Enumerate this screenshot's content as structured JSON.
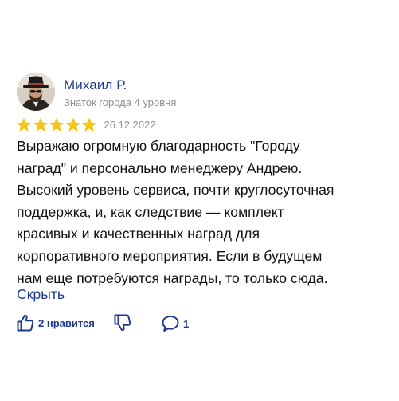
{
  "review": {
    "author": {
      "name": "Михаил Р.",
      "level": "Знаток города 4 уровня"
    },
    "rating": 5,
    "rating_max": 5,
    "date": "26.12.2022",
    "text_lines": [
      "Выражаю огромную благодарность \"Городу",
      "наград\" и персонально менеджеру Андрею.",
      "Высокий уровень сервиса, почти круглосуточная",
      "поддержка, и, как следствие — комплект",
      "красивых и качественных наград для",
      "корпоративного мероприятия. Если в будущем",
      "нам еще потребуются награды, то только сюда."
    ],
    "collapse_label": "Скрыть",
    "likes_label": "2 нравится",
    "comments_count": "1"
  },
  "colors": {
    "accent": "#1e3a8a",
    "star": "#f5c518",
    "muted": "#8a8f98",
    "text": "#111111"
  },
  "icons": {
    "like": "thumbs-up-icon",
    "dislike": "thumbs-down-icon",
    "comments": "speech-bubble-icon",
    "star": "star-icon"
  }
}
